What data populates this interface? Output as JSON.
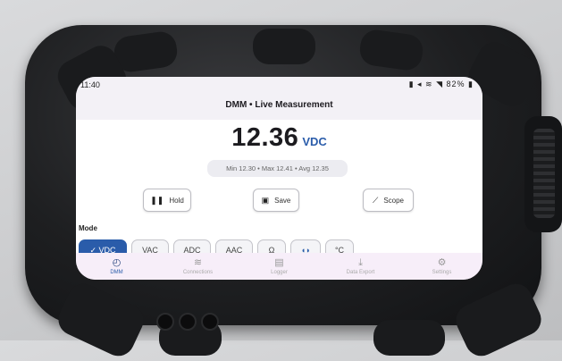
{
  "status_bar": {
    "time": "11:40",
    "battery": "82%"
  },
  "app_bar": {
    "title": "DMM • Live Measurement"
  },
  "reading": {
    "value": "12.36",
    "unit": "VDC",
    "stats": "Min 12.30  •  Max 12.41  •  Avg 12.35"
  },
  "actions": {
    "hold": "Hold",
    "save": "Save",
    "scope": "Scope"
  },
  "mode": {
    "label": "Mode",
    "options": [
      "VDC",
      "VAC",
      "ADC",
      "AAC",
      "Ω",
      "",
      "°C"
    ],
    "selected": "VDC"
  },
  "nav": {
    "items": [
      {
        "label": "DMM",
        "icon": "gauge-icon",
        "active": true
      },
      {
        "label": "Connections",
        "icon": "wifi-icon"
      },
      {
        "label": "Logger",
        "icon": "list-icon"
      },
      {
        "label": "Data Export",
        "icon": "download-icon"
      },
      {
        "label": "Settings",
        "icon": "gear-icon"
      }
    ]
  },
  "colors": {
    "accent": "#2a5caa",
    "nav_bg": "#f7eef9",
    "case": "#1e1f21"
  }
}
